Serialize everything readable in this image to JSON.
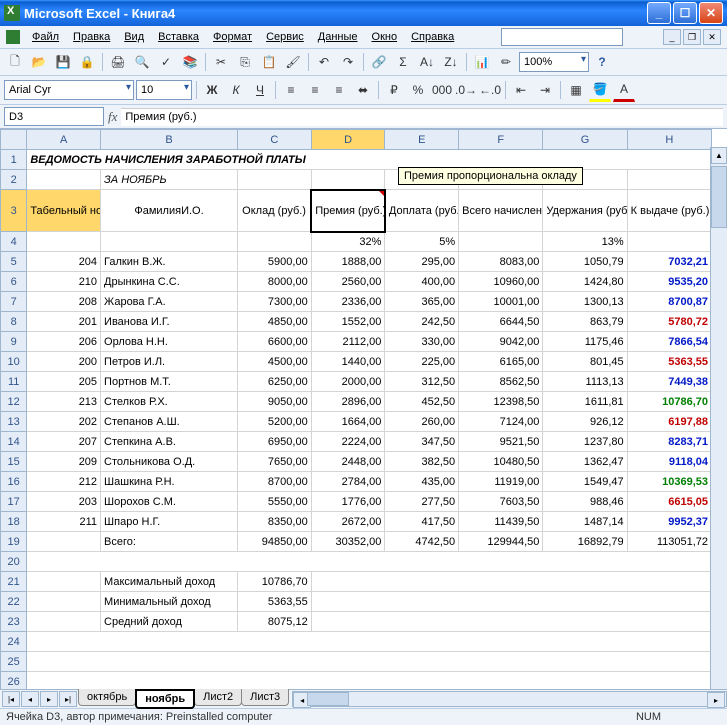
{
  "title": "Microsoft Excel - Книга4",
  "menu": {
    "file": "Файл",
    "edit": "Правка",
    "view": "Вид",
    "insert": "Вставка",
    "format": "Формат",
    "tools": "Сервис",
    "data": "Данные",
    "window": "Окно",
    "help": "Справка"
  },
  "zoom": "100%",
  "font_name": "Arial Cyr",
  "font_size": "10",
  "name_box": "D3",
  "formula_bar": "Премия (руб.)",
  "tooltip": "Премия пропорциональна окладу",
  "cols": [
    "A",
    "B",
    "C",
    "D",
    "E",
    "F",
    "G",
    "H"
  ],
  "r1": {
    "a": "ВЕДОМОСТЬ НАЧИСЛЕНИЯ ЗАРАБОТНОЙ ПЛАТЫ"
  },
  "r2": {
    "b": "ЗА НОЯБРЬ"
  },
  "hdr": {
    "a": "Табельный номер",
    "b": "ФамилияИ.О.",
    "c": "Оклад (руб.)",
    "d": "Премия (руб.)",
    "e": "Доплата (руб.)",
    "f": "Всего начислено (руб.)",
    "g": "Удержания (руб.)",
    "h": "К выдаче (руб.)"
  },
  "pct": {
    "d": "32%",
    "e": "5%",
    "g": "13%"
  },
  "rows": [
    {
      "a": "204",
      "b": "Галкин В.Ж.",
      "c": "5900,00",
      "d": "1888,00",
      "e": "295,00",
      "f": "8083,00",
      "g": "1050,79",
      "h": "7032,21",
      "cls": "blue"
    },
    {
      "a": "210",
      "b": "Дрынкина С.С.",
      "c": "8000,00",
      "d": "2560,00",
      "e": "400,00",
      "f": "10960,00",
      "g": "1424,80",
      "h": "9535,20",
      "cls": "blue"
    },
    {
      "a": "208",
      "b": "Жарова Г.А.",
      "c": "7300,00",
      "d": "2336,00",
      "e": "365,00",
      "f": "10001,00",
      "g": "1300,13",
      "h": "8700,87",
      "cls": "blue"
    },
    {
      "a": "201",
      "b": "Иванова И.Г.",
      "c": "4850,00",
      "d": "1552,00",
      "e": "242,50",
      "f": "6644,50",
      "g": "863,79",
      "h": "5780,72",
      "cls": "red"
    },
    {
      "a": "206",
      "b": "Орлова Н.Н.",
      "c": "6600,00",
      "d": "2112,00",
      "e": "330,00",
      "f": "9042,00",
      "g": "1175,46",
      "h": "7866,54",
      "cls": "blue"
    },
    {
      "a": "200",
      "b": "Петров И.Л.",
      "c": "4500,00",
      "d": "1440,00",
      "e": "225,00",
      "f": "6165,00",
      "g": "801,45",
      "h": "5363,55",
      "cls": "red"
    },
    {
      "a": "205",
      "b": "Портнов М.Т.",
      "c": "6250,00",
      "d": "2000,00",
      "e": "312,50",
      "f": "8562,50",
      "g": "1113,13",
      "h": "7449,38",
      "cls": "blue"
    },
    {
      "a": "213",
      "b": "Стелков Р.Х.",
      "c": "9050,00",
      "d": "2896,00",
      "e": "452,50",
      "f": "12398,50",
      "g": "1611,81",
      "h": "10786,70",
      "cls": "green"
    },
    {
      "a": "202",
      "b": "Степанов А.Ш.",
      "c": "5200,00",
      "d": "1664,00",
      "e": "260,00",
      "f": "7124,00",
      "g": "926,12",
      "h": "6197,88",
      "cls": "red"
    },
    {
      "a": "207",
      "b": "Степкина А.В.",
      "c": "6950,00",
      "d": "2224,00",
      "e": "347,50",
      "f": "9521,50",
      "g": "1237,80",
      "h": "8283,71",
      "cls": "blue"
    },
    {
      "a": "209",
      "b": "Стольникова О.Д.",
      "c": "7650,00",
      "d": "2448,00",
      "e": "382,50",
      "f": "10480,50",
      "g": "1362,47",
      "h": "9118,04",
      "cls": "blue"
    },
    {
      "a": "212",
      "b": "Шашкина Р.Н.",
      "c": "8700,00",
      "d": "2784,00",
      "e": "435,00",
      "f": "11919,00",
      "g": "1549,47",
      "h": "10369,53",
      "cls": "green"
    },
    {
      "a": "203",
      "b": "Шорохов С.М.",
      "c": "5550,00",
      "d": "1776,00",
      "e": "277,50",
      "f": "7603,50",
      "g": "988,46",
      "h": "6615,05",
      "cls": "red"
    },
    {
      "a": "211",
      "b": "Шпаро Н.Г.",
      "c": "8350,00",
      "d": "2672,00",
      "e": "417,50",
      "f": "11439,50",
      "g": "1487,14",
      "h": "9952,37",
      "cls": "blue"
    }
  ],
  "total": {
    "b": "Всего:",
    "c": "94850,00",
    "d": "30352,00",
    "e": "4742,50",
    "f": "129944,50",
    "g": "16892,79",
    "h": "113051,72"
  },
  "stats": {
    "max_l": "Максимальный доход",
    "max_v": "10786,70",
    "min_l": "Минимальный доход",
    "min_v": "5363,55",
    "avg_l": "Средний доход",
    "avg_v": "8075,12"
  },
  "tabs": [
    "октябрь",
    "ноябрь",
    "Лист2",
    "Лист3"
  ],
  "active_tab": "ноябрь",
  "status": "Ячейка D3, автор примечания: Preinstalled computer",
  "status_num": "NUM"
}
